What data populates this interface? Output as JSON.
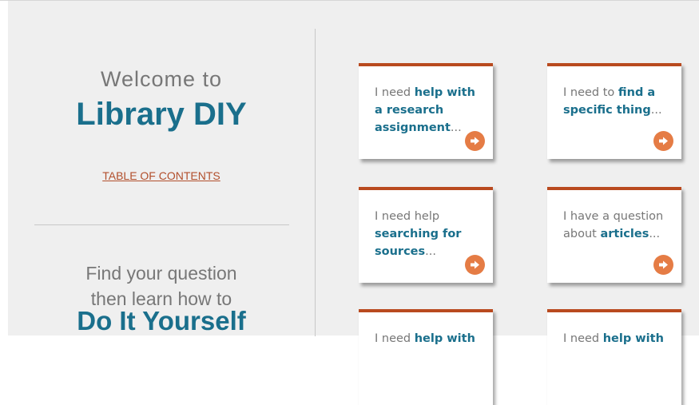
{
  "left_panel": {
    "welcome": "Welcome to",
    "title": "Library DIY",
    "toc_link": "TABLE OF CONTENTS",
    "find_line1": "Find your question",
    "find_line2": "then learn how to",
    "diy": "Do It Yourself"
  },
  "cards": [
    {
      "lead": "I need ",
      "bold": "help with a research assignment",
      "tail": "..."
    },
    {
      "lead": "I need to ",
      "bold": "find a specific thing",
      "tail": "..."
    },
    {
      "lead": "I need help ",
      "bold": "searching for sources",
      "tail": "..."
    },
    {
      "lead": "I have a question about ",
      "bold": "articles",
      "tail": "..."
    },
    {
      "lead": "I need ",
      "bold": "help with",
      "tail": ""
    },
    {
      "lead": "I need ",
      "bold": "help with",
      "tail": ""
    }
  ],
  "icons": {
    "card_arrow": "arrow-right-icon"
  },
  "colors": {
    "accent_blue": "#1a6f8c",
    "accent_rust": "#b94a1f",
    "arrow_orange": "#e57c45"
  }
}
